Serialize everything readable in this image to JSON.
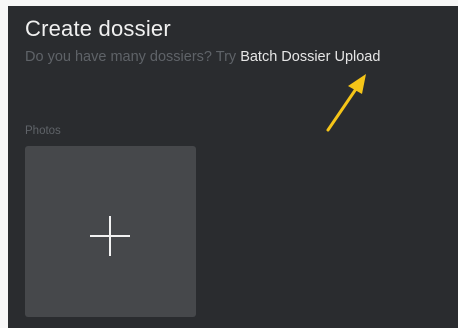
{
  "header": {
    "title": "Create dossier",
    "subtitle_prefix": "Do you have many dossiers? Try ",
    "subtitle_link": "Batch Dossier Upload"
  },
  "photos": {
    "label": "Photos",
    "add_icon": "plus-icon"
  },
  "annotation": {
    "arrow_color": "#f5c518"
  }
}
